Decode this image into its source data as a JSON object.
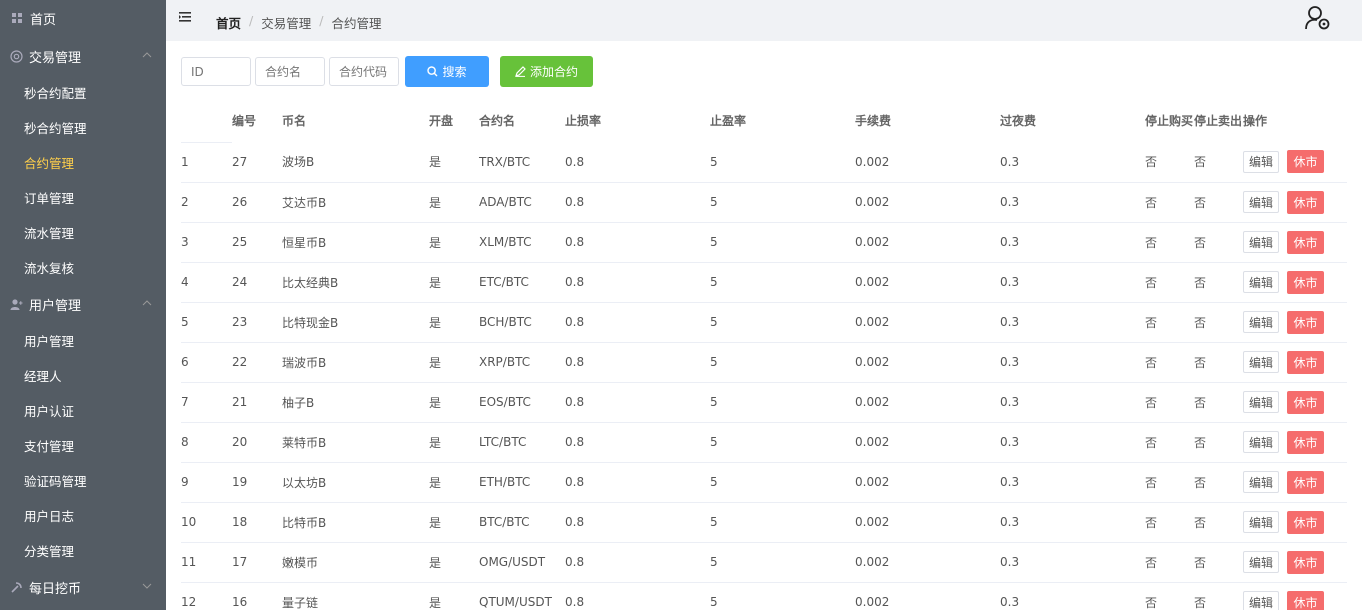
{
  "sidebar": {
    "home": "首页",
    "groups": [
      {
        "label": "交易管理",
        "items": [
          "秒合约配置",
          "秒合约管理",
          "合约管理",
          "订单管理",
          "流水管理",
          "流水复核"
        ],
        "active": 2
      },
      {
        "label": "用户管理",
        "items": [
          "用户管理",
          "经理人",
          "用户认证",
          "支付管理",
          "验证码管理",
          "用户日志",
          "分类管理"
        ],
        "active": -1
      },
      {
        "label": "每日挖币",
        "items": [],
        "active": -1
      }
    ]
  },
  "breadcrumb": [
    "首页",
    "交易管理",
    "合约管理"
  ],
  "toolbar": {
    "id_placeholder": "ID",
    "name_placeholder": "合约名",
    "code_placeholder": "合约代码",
    "search_label": "搜索",
    "add_label": "添加合约"
  },
  "table": {
    "headers": [
      "",
      "编号",
      "币名",
      "开盘",
      "合约名",
      "止损率",
      "止盈率",
      "手续费",
      "过夜费",
      "停止购买",
      "停止卖出",
      "操作"
    ],
    "edit_label": "编辑",
    "close_label": "休市",
    "rows": [
      [
        "1",
        "27",
        "波场B",
        "是",
        "TRX/BTC",
        "0.8",
        "5",
        "0.002",
        "0.3",
        "否",
        "否"
      ],
      [
        "2",
        "26",
        "艾达币B",
        "是",
        "ADA/BTC",
        "0.8",
        "5",
        "0.002",
        "0.3",
        "否",
        "否"
      ],
      [
        "3",
        "25",
        "恒星币B",
        "是",
        "XLM/BTC",
        "0.8",
        "5",
        "0.002",
        "0.3",
        "否",
        "否"
      ],
      [
        "4",
        "24",
        "比太经典B",
        "是",
        "ETC/BTC",
        "0.8",
        "5",
        "0.002",
        "0.3",
        "否",
        "否"
      ],
      [
        "5",
        "23",
        "比特现金B",
        "是",
        "BCH/BTC",
        "0.8",
        "5",
        "0.002",
        "0.3",
        "否",
        "否"
      ],
      [
        "6",
        "22",
        "瑞波币B",
        "是",
        "XRP/BTC",
        "0.8",
        "5",
        "0.002",
        "0.3",
        "否",
        "否"
      ],
      [
        "7",
        "21",
        "柚子B",
        "是",
        "EOS/BTC",
        "0.8",
        "5",
        "0.002",
        "0.3",
        "否",
        "否"
      ],
      [
        "8",
        "20",
        "莱特币B",
        "是",
        "LTC/BTC",
        "0.8",
        "5",
        "0.002",
        "0.3",
        "否",
        "否"
      ],
      [
        "9",
        "19",
        "以太坊B",
        "是",
        "ETH/BTC",
        "0.8",
        "5",
        "0.002",
        "0.3",
        "否",
        "否"
      ],
      [
        "10",
        "18",
        "比特币B",
        "是",
        "BTC/BTC",
        "0.8",
        "5",
        "0.002",
        "0.3",
        "否",
        "否"
      ],
      [
        "11",
        "17",
        "嫩模币",
        "是",
        "OMG/USDT",
        "0.8",
        "5",
        "0.002",
        "0.3",
        "否",
        "否"
      ],
      [
        "12",
        "16",
        "量子链",
        "是",
        "QTUM/USDT",
        "0.8",
        "5",
        "0.002",
        "0.3",
        "否",
        "否"
      ]
    ]
  },
  "colors": {
    "sidebar_bg": "#545c64",
    "active_item": "#ffd04b",
    "search_btn": "#409eff",
    "add_btn": "#67c23a",
    "close_btn": "#f56c6c"
  }
}
